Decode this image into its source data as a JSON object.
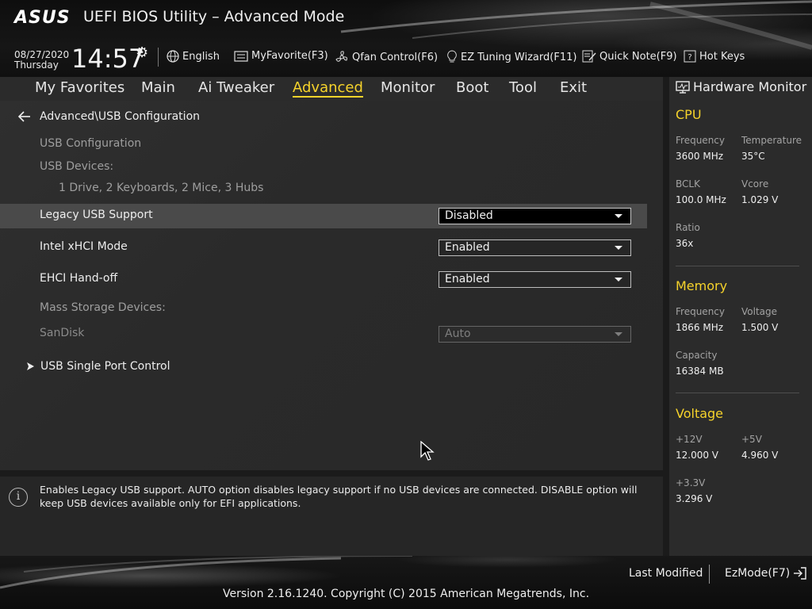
{
  "header": {
    "logo": "ASUS",
    "title": "UEFI BIOS Utility – Advanced Mode",
    "date": "08/27/2020",
    "day": "Thursday",
    "time": "14:57",
    "toolbar": {
      "language": "English",
      "my_favorite": "MyFavorite(F3)",
      "qfan": "Qfan Control(F6)",
      "ez_tuning": "EZ Tuning Wizard(F11)",
      "quick_note": "Quick Note(F9)",
      "hot_keys": "Hot Keys"
    }
  },
  "nav": {
    "tabs": [
      {
        "label": "My Favorites"
      },
      {
        "label": "Main"
      },
      {
        "label": "Ai Tweaker"
      },
      {
        "label": "Advanced",
        "active": true
      },
      {
        "label": "Monitor"
      },
      {
        "label": "Boot"
      },
      {
        "label": "Tool"
      },
      {
        "label": "Exit"
      }
    ]
  },
  "main": {
    "breadcrumb": "Advanced\\USB Configuration",
    "section_title": "USB Configuration",
    "usb_devices_label": "USB Devices:",
    "usb_devices_value": "1 Drive, 2 Keyboards, 2 Mice, 3 Hubs",
    "settings": [
      {
        "label": "Legacy USB Support",
        "value": "Disabled",
        "selected": true
      },
      {
        "label": "Intel xHCI Mode",
        "value": "Enabled"
      },
      {
        "label": "EHCI Hand-off",
        "value": "Enabled"
      }
    ],
    "mass_storage_label": "Mass Storage Devices:",
    "sandisk": {
      "label": "SanDisk",
      "value": "Auto",
      "disabled": true
    },
    "submenu": "USB Single Port Control"
  },
  "help": {
    "text": "Enables Legacy USB support. AUTO option disables legacy support if no USB devices are connected. DISABLE option will keep USB devices available only for EFI applications."
  },
  "hardware_monitor": {
    "title": "Hardware Monitor",
    "cpu": {
      "heading": "CPU",
      "frequency_label": "Frequency",
      "frequency": "3600 MHz",
      "temperature_label": "Temperature",
      "temperature": "35°C",
      "bclk_label": "BCLK",
      "bclk": "100.0 MHz",
      "vcore_label": "Vcore",
      "vcore": "1.029 V",
      "ratio_label": "Ratio",
      "ratio": "36x"
    },
    "memory": {
      "heading": "Memory",
      "frequency_label": "Frequency",
      "frequency": "1866 MHz",
      "voltage_label": "Voltage",
      "voltage": "1.500 V",
      "capacity_label": "Capacity",
      "capacity": "16384 MB"
    },
    "voltage": {
      "heading": "Voltage",
      "v12_label": "+12V",
      "v12": "12.000 V",
      "v5_label": "+5V",
      "v5": "4.960 V",
      "v33_label": "+3.3V",
      "v33": "3.296 V"
    }
  },
  "footer": {
    "last_modified": "Last Modified",
    "ezmode": "EzMode(F7)",
    "copyright": "Version 2.16.1240. Copyright (C) 2015 American Megatrends, Inc."
  },
  "colors": {
    "accent": "#f6d32b",
    "highlight_row": "#4a4a4a",
    "panel": "#2b2b2b"
  }
}
